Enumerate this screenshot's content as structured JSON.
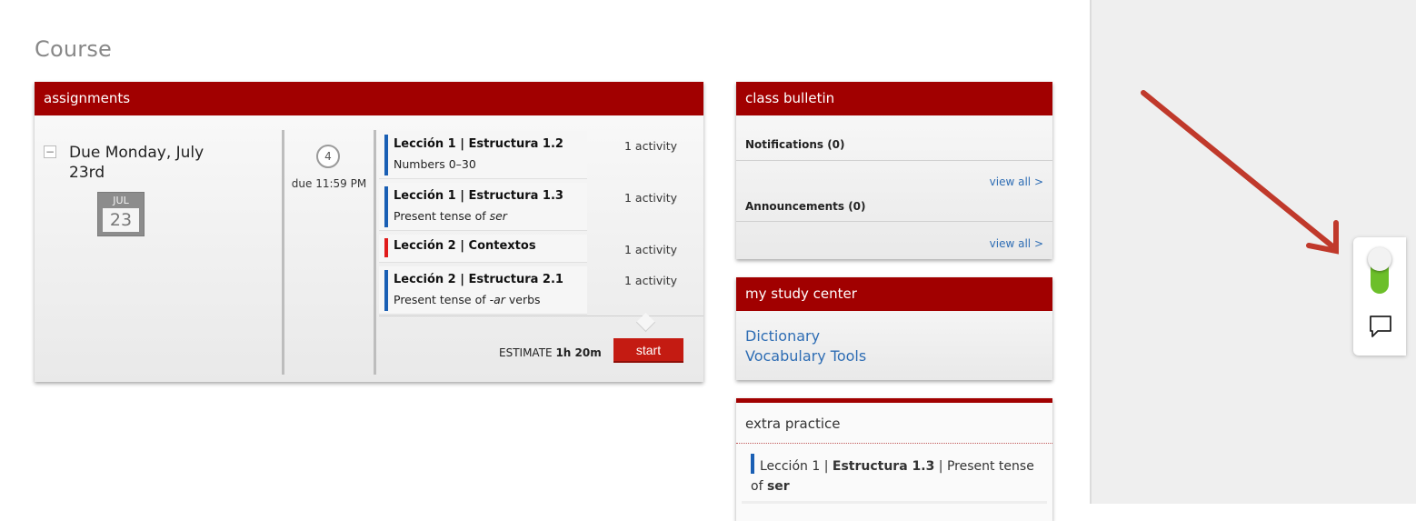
{
  "page": {
    "title": "Course"
  },
  "assignments": {
    "header": "assignments",
    "due_label": "Due Monday, July 23rd",
    "calendar": {
      "month": "JUL",
      "day": "23"
    },
    "count": "4",
    "due_time": "due 11:59 PM",
    "items": [
      {
        "title": "Lección 1 | Estructura 1.2",
        "subtitle": "Numbers 0–30",
        "activity": "1 activity",
        "color": "#1a5fb4"
      },
      {
        "title": "Lección 1 | Estructura 1.3",
        "subtitle_pre": "Present tense of ",
        "subtitle_em": "ser",
        "activity": "1 activity",
        "color": "#1a5fb4"
      },
      {
        "title": "Lección 2 | Contextos",
        "activity": "1 activity",
        "color": "#e01b1b"
      },
      {
        "title": "Lección 2 | Estructura 2.1",
        "subtitle_pre": "Present tense of ",
        "subtitle_em": "-ar",
        "subtitle_post": " verbs",
        "activity": "1 activity",
        "color": "#1a5fb4"
      }
    ],
    "estimate_label": "ESTIMATE",
    "estimate_value": "1h 20m",
    "start_label": "start"
  },
  "bulletin": {
    "header": "class bulletin",
    "notifications": "Notifications (0)",
    "announcements": "Announcements (0)",
    "view_all_1": "view all >",
    "view_all_2": "view all >"
  },
  "study_center": {
    "header": "my study center",
    "links": [
      "Dictionary",
      "Vocabulary Tools"
    ]
  },
  "extra_practice": {
    "header": "extra practice",
    "item_pre": "Lección 1 | ",
    "item_bold": "Estructura 1.3",
    "item_mid": " | Present tense of ",
    "item_bold2": "ser"
  },
  "colors": {
    "brand_red": "#a10000",
    "link_blue": "#2e6db4",
    "toggle_green": "#6cbf2a",
    "arrow_red": "#c0392b"
  },
  "widget": {
    "toggle_state": "on",
    "icons": [
      "toggle-icon",
      "chat-icon"
    ]
  }
}
